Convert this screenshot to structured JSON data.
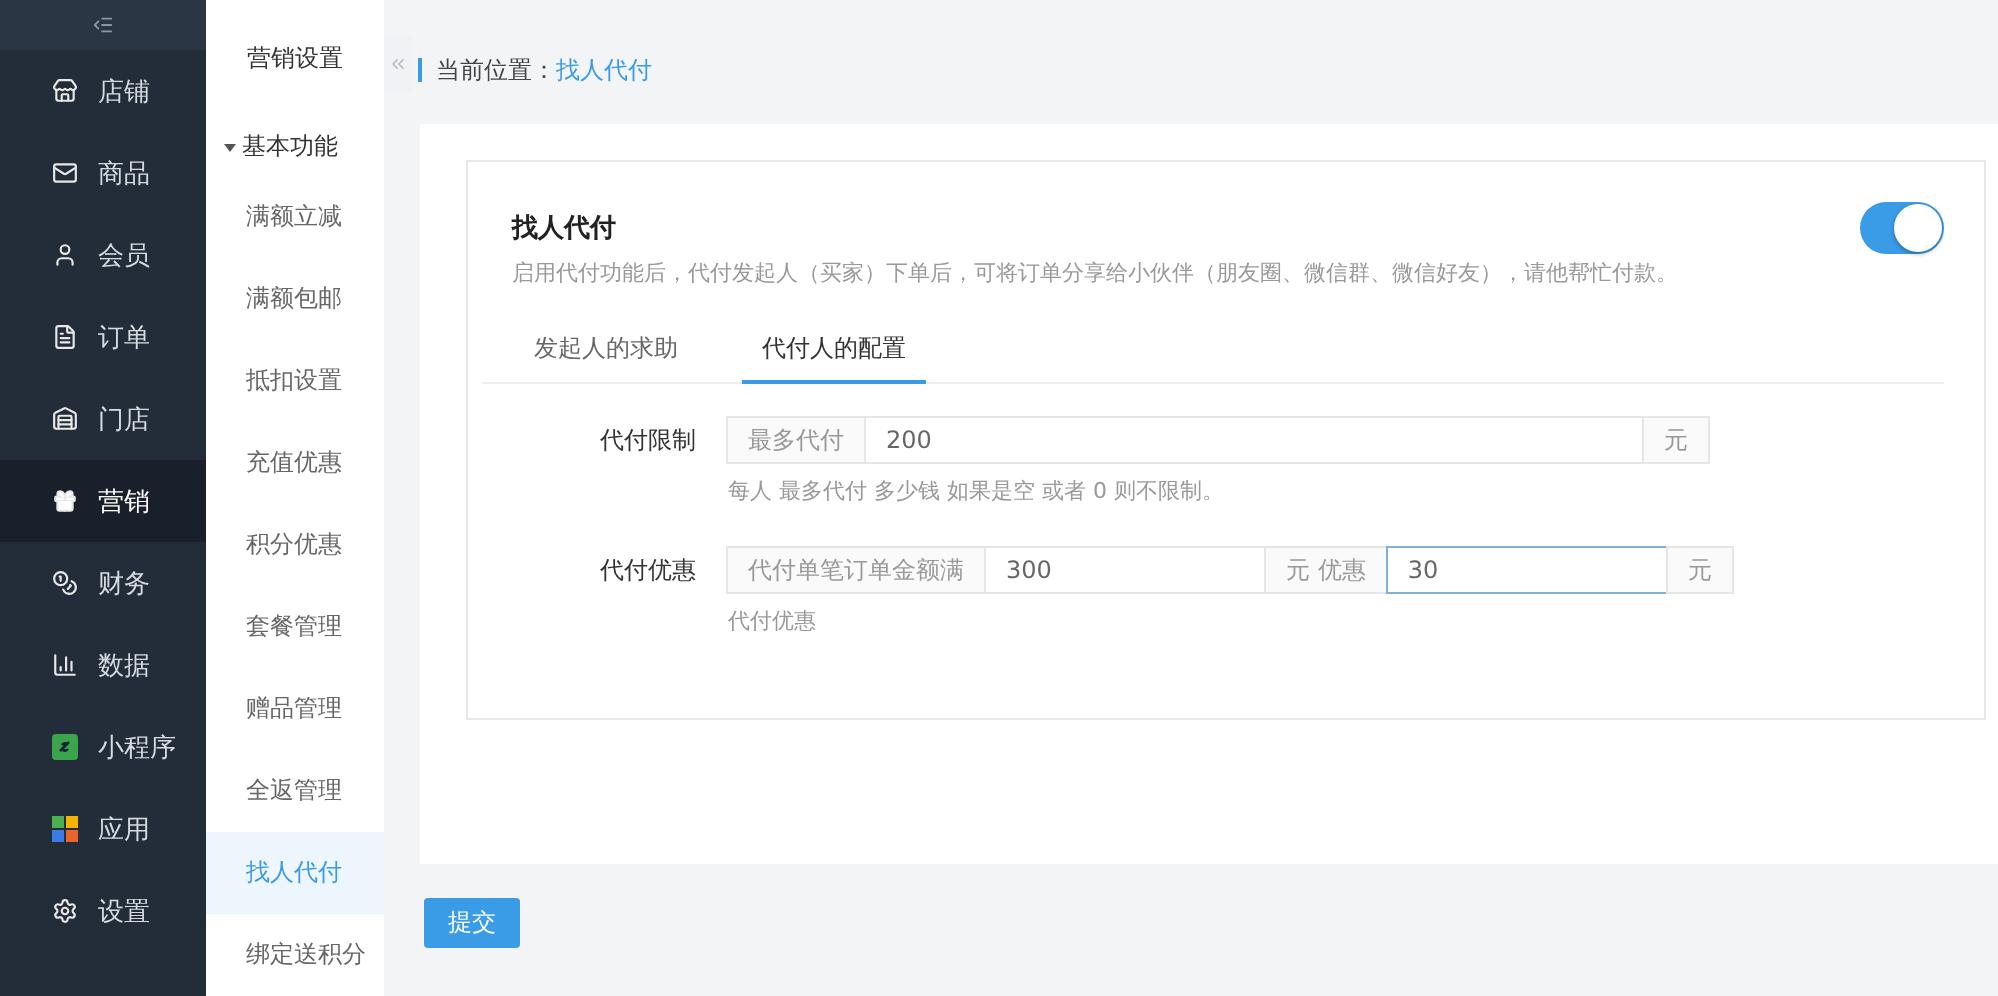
{
  "nav": {
    "items": [
      {
        "label": "店铺",
        "selected": false
      },
      {
        "label": "商品",
        "selected": false
      },
      {
        "label": "会员",
        "selected": false
      },
      {
        "label": "订单",
        "selected": false
      },
      {
        "label": "门店",
        "selected": false
      },
      {
        "label": "营销",
        "selected": true
      },
      {
        "label": "财务",
        "selected": false
      },
      {
        "label": "数据",
        "selected": false
      },
      {
        "label": "小程序",
        "selected": false
      },
      {
        "label": "应用",
        "selected": false
      },
      {
        "label": "设置",
        "selected": false
      }
    ]
  },
  "submenu": {
    "title": "营销设置",
    "groups": [
      {
        "label": "基本功能",
        "expanded": true,
        "children": [
          {
            "label": "满额立减",
            "selected": false
          },
          {
            "label": "满额包邮",
            "selected": false
          },
          {
            "label": "抵扣设置",
            "selected": false
          },
          {
            "label": "充值优惠",
            "selected": false
          },
          {
            "label": "积分优惠",
            "selected": false
          },
          {
            "label": "套餐管理",
            "selected": false
          },
          {
            "label": "赠品管理",
            "selected": false
          },
          {
            "label": "全返管理",
            "selected": false
          },
          {
            "label": "找人代付",
            "selected": true
          },
          {
            "label": "绑定送积分",
            "selected": false
          }
        ]
      }
    ]
  },
  "breadcrumb": {
    "label": "当前位置：",
    "current": "找人代付"
  },
  "card": {
    "title": "找人代付",
    "description": "启用代付功能后，代付发起人（买家）下单后，可将订单分享给小伙伴（朋友圈、微信群、微信好友），请他帮忙付款。",
    "enabled": true
  },
  "tabs": [
    {
      "label": "发起人的求助",
      "selected": false
    },
    {
      "label": "代付人的配置",
      "selected": true
    }
  ],
  "form": [
    {
      "label": "代付限制",
      "segments": [
        {
          "kind": "addon",
          "text": "最多代付"
        },
        {
          "kind": "input",
          "value": "200",
          "focused": false
        },
        {
          "kind": "addon",
          "text": "元"
        }
      ],
      "help": "每人 最多代付 多少钱 如果是空 或者 0 则不限制。"
    },
    {
      "label": "代付优惠",
      "segments": [
        {
          "kind": "addon",
          "text": "代付单笔订单金额满"
        },
        {
          "kind": "input",
          "value": "300",
          "focused": false
        },
        {
          "kind": "addon",
          "text": "元 优惠"
        },
        {
          "kind": "input",
          "value": "30",
          "focused": true
        },
        {
          "kind": "addon",
          "text": "元"
        }
      ],
      "help": "代付优惠"
    }
  ],
  "submit": "提交"
}
